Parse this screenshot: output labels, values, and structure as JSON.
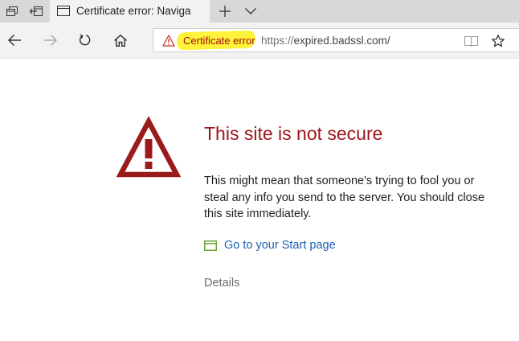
{
  "tab": {
    "title": "Certificate error: Naviga"
  },
  "address_bar": {
    "security_label": "Certificate error",
    "url_scheme": "https://",
    "url_host": "expired.badssl.com/"
  },
  "error_page": {
    "title": "This site is not secure",
    "body": "This might mean that someone's trying to fool you or steal any info you send to the server. You should close this site immediately.",
    "start_page_link": "Go to your Start page",
    "details_link": "Details"
  },
  "colors": {
    "error_red": "#a0141c",
    "warning_icon_red": "#9b1b1b",
    "link_blue": "#1a5fb4",
    "highlight_yellow": "#fff23a"
  },
  "icons": {
    "tab_preview": "tab-preview-icon",
    "set_aside": "set-aside-tabs-icon",
    "tab_favicon": "page-favicon-icon",
    "new_tab": "plus-icon",
    "tab_menu": "chevron-down-icon",
    "back": "back-arrow-icon",
    "forward": "forward-arrow-icon",
    "refresh": "refresh-icon",
    "home": "home-icon",
    "address_warning": "warning-icon",
    "reading_view": "reading-view-icon",
    "favorite": "star-icon",
    "big_warning": "warning-triangle-icon",
    "start_page": "start-page-icon"
  }
}
